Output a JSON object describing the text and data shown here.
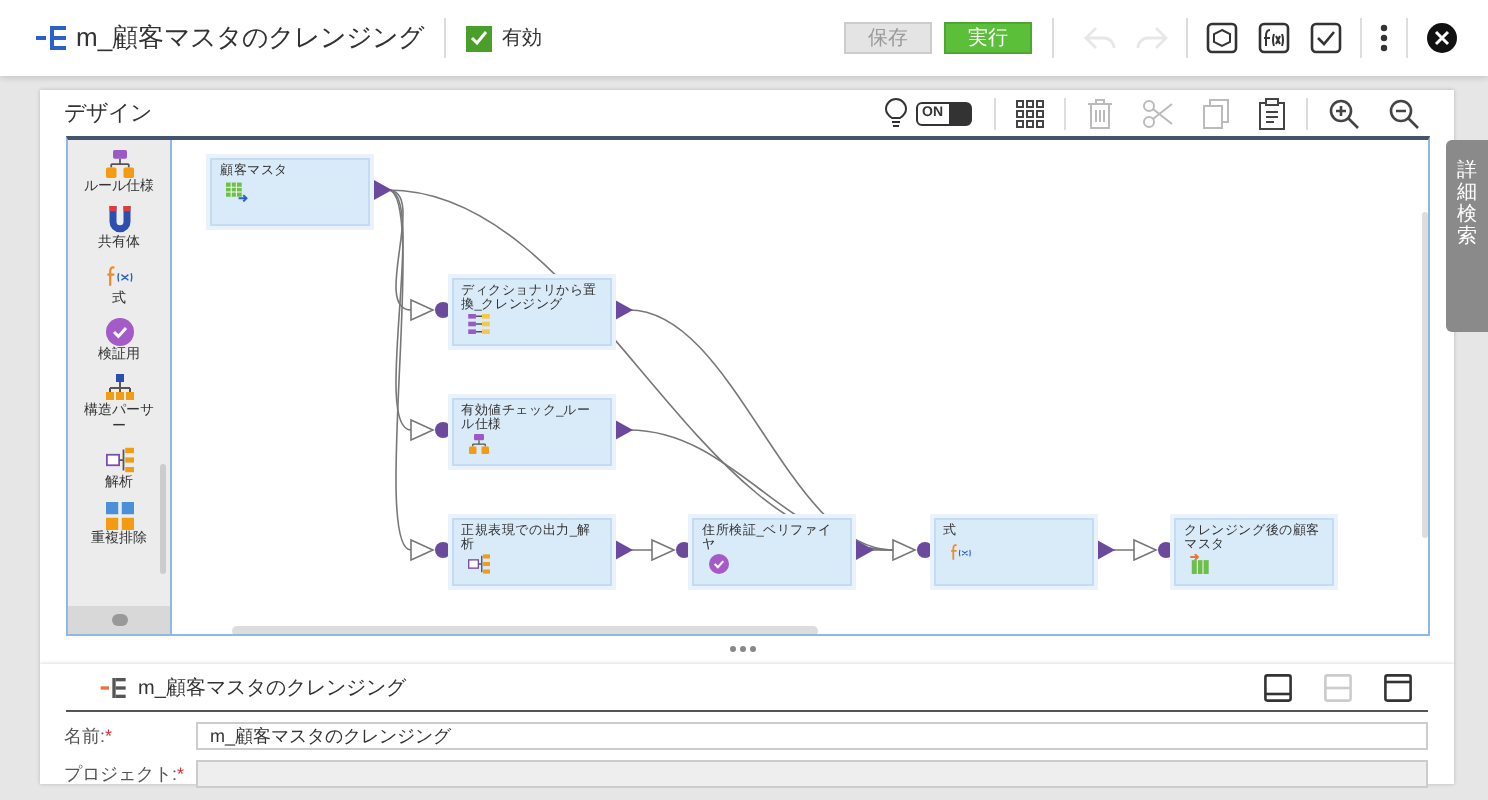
{
  "header": {
    "title": "m_顧客マスタのクレンジング",
    "enabled": {
      "label": "有効",
      "checked": true
    },
    "buttons": [
      {
        "label": "保存",
        "kind": "save",
        "disabled": true
      },
      {
        "label": "実行",
        "kind": "run",
        "disabled": false
      }
    ],
    "tools": [
      {
        "kind": "undo",
        "disabled": true
      },
      {
        "kind": "redo",
        "disabled": true
      },
      {
        "kind": "validate",
        "disabled": false
      },
      {
        "kind": "formula",
        "disabled": false
      },
      {
        "kind": "check",
        "disabled": false
      },
      {
        "kind": "more",
        "disabled": false
      },
      {
        "kind": "close",
        "disabled": false
      }
    ]
  },
  "design": {
    "title": "デザイン",
    "toggle": {
      "label": "ON",
      "on": true
    },
    "tools": [
      {
        "kind": "grid",
        "disabled": false
      },
      {
        "kind": "delete",
        "disabled": true
      },
      {
        "kind": "cut",
        "disabled": true
      },
      {
        "kind": "copy",
        "disabled": true
      },
      {
        "kind": "paste",
        "disabled": false
      },
      {
        "kind": "zoom-in",
        "disabled": false
      },
      {
        "kind": "zoom-out",
        "disabled": false
      }
    ],
    "palette": [
      {
        "label": "ルール仕様",
        "kind": "rule"
      },
      {
        "label": "共有体",
        "kind": "union"
      },
      {
        "label": "式",
        "kind": "expression"
      },
      {
        "label": "検証用",
        "kind": "verify"
      },
      {
        "label": "構造パーサー",
        "kind": "parser"
      },
      {
        "label": "解析",
        "kind": "parse"
      },
      {
        "label": "重複排除",
        "kind": "dedupe"
      }
    ],
    "nodes": [
      {
        "label": "顧客マスタ",
        "kind": "source"
      },
      {
        "label": "ディクショナリから置換_クレンジング",
        "kind": "standardizer"
      },
      {
        "label": "有効値チェック_ルール仕様",
        "kind": "rule"
      },
      {
        "label": "正規表現での出力_解析",
        "kind": "parse"
      },
      {
        "label": "住所検証_ベリファイヤ",
        "kind": "verify"
      },
      {
        "label": "式",
        "kind": "expression"
      },
      {
        "label": "クレンジング後の顧客マスタ",
        "kind": "target"
      }
    ],
    "side_tab": "詳細検索"
  },
  "properties": {
    "title": "m_顧客マスタのクレンジング",
    "layouts": [
      {
        "kind": "bottom",
        "disabled": false
      },
      {
        "kind": "split",
        "disabled": true
      },
      {
        "kind": "top",
        "disabled": false
      }
    ],
    "fields": [
      {
        "label": "名前:",
        "required_mark": "*",
        "value": "m_顧客マスタのクレンジング"
      },
      {
        "label": "プロジェクト:",
        "required_mark": "*"
      }
    ]
  }
}
